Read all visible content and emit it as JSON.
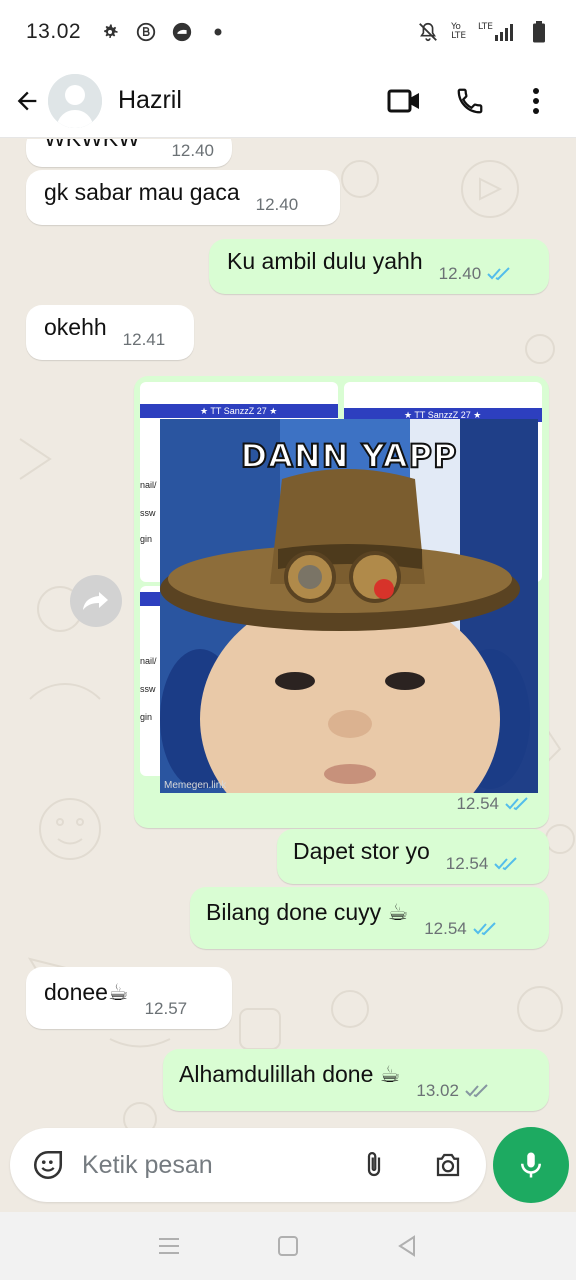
{
  "status_bar": {
    "time": "13.02",
    "net_label_top": "Yo",
    "net_label_bottom": "LTE",
    "lte_label": "LTE"
  },
  "header": {
    "contact_name": "Hazril"
  },
  "messages": [
    {
      "direction": "in",
      "text": "WKWKW",
      "time": "12.40"
    },
    {
      "direction": "in",
      "text": "gk sabar mau gaca",
      "time": "12.40"
    },
    {
      "direction": "out",
      "text": "Ku ambil dulu yahh",
      "time": "12.40",
      "status": "read"
    },
    {
      "direction": "in",
      "text": "okehh",
      "time": "12.41"
    },
    {
      "direction": "out",
      "type": "image",
      "time": "12.54",
      "status": "read",
      "thumb_title": "★ TT SanzzZ 27 ★",
      "field_labels": [
        "nail/",
        "ssw",
        "gin"
      ],
      "meme_caption": "DANN YAPP",
      "watermark": "Memegen.link"
    },
    {
      "direction": "out",
      "text": "Dapet stor yo",
      "time": "12.54",
      "status": "read"
    },
    {
      "direction": "out",
      "text": "Bilang done cuyy ☕",
      "time": "12.54",
      "status": "read"
    },
    {
      "direction": "in",
      "text": "donee☕",
      "time": "12.57"
    },
    {
      "direction": "out",
      "text": "Alhamdulillah done ☕",
      "time": "13.02",
      "status": "delivered"
    }
  ],
  "composer": {
    "placeholder": "Ketik pesan"
  },
  "colors": {
    "incoming": "#ffffff",
    "outgoing": "#d9fdd3",
    "read_tick": "#53bdeb",
    "delivered_tick": "#8696a0",
    "accent": "#1daa61"
  },
  "icons": [
    "back-arrow-icon",
    "avatar-icon",
    "video-call-icon",
    "phone-icon",
    "more-icon",
    "forward-icon",
    "sticker-icon",
    "attach-icon",
    "camera-icon",
    "mic-icon"
  ]
}
